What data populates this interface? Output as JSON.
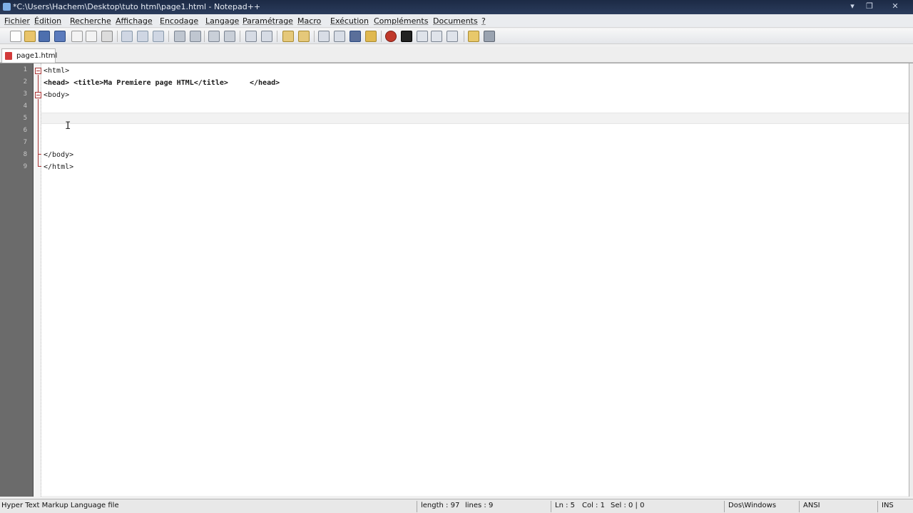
{
  "window": {
    "title": "*C:\\Users\\Hachem\\Desktop\\tuto html\\page1.html - Notepad++",
    "minimize_glyph": "▾",
    "restore_glyph": "❐",
    "close_glyph": "✕"
  },
  "menu": {
    "items": [
      {
        "label": "Fichier"
      },
      {
        "label": "Édition"
      },
      {
        "label": "Recherche"
      },
      {
        "label": "Affichage"
      },
      {
        "label": "Encodage"
      },
      {
        "label": "Langage"
      },
      {
        "label": "Paramétrage"
      },
      {
        "label": "Macro"
      },
      {
        "label": "Exécution"
      },
      {
        "label": "Compléments"
      },
      {
        "label": "Documents"
      },
      {
        "label": "?"
      }
    ]
  },
  "tabs": [
    {
      "label": "page1.html",
      "active": true,
      "modified": true
    }
  ],
  "editor": {
    "lines": [
      {
        "number": "1",
        "text": "<html>"
      },
      {
        "number": "2",
        "text": "<head> <title>Ma Premiere page HTML</title>     </head>"
      },
      {
        "number": "3",
        "text": "<body>"
      },
      {
        "number": "4",
        "text": ""
      },
      {
        "number": "5",
        "text": ""
      },
      {
        "number": "6",
        "text": ""
      },
      {
        "number": "7",
        "text": ""
      },
      {
        "number": "8",
        "text": "</body>"
      },
      {
        "number": "9",
        "text": "</html>"
      }
    ],
    "cursor_glyph": "I"
  },
  "status": {
    "file_type": "Hyper Text Markup Language file",
    "length": "length : 97",
    "lines": "lines : 9",
    "ln": "Ln : 5",
    "col": "Col : 1",
    "sel": "Sel : 0 | 0",
    "eol": "Dos\\Windows",
    "encoding": "ANSI",
    "mode": "INS"
  },
  "colors": {
    "titlebar": "#1c2a45",
    "gutter": "#6b6b6b",
    "fold_marker": "#aa3333",
    "tab_icon": "#d23a3a"
  }
}
